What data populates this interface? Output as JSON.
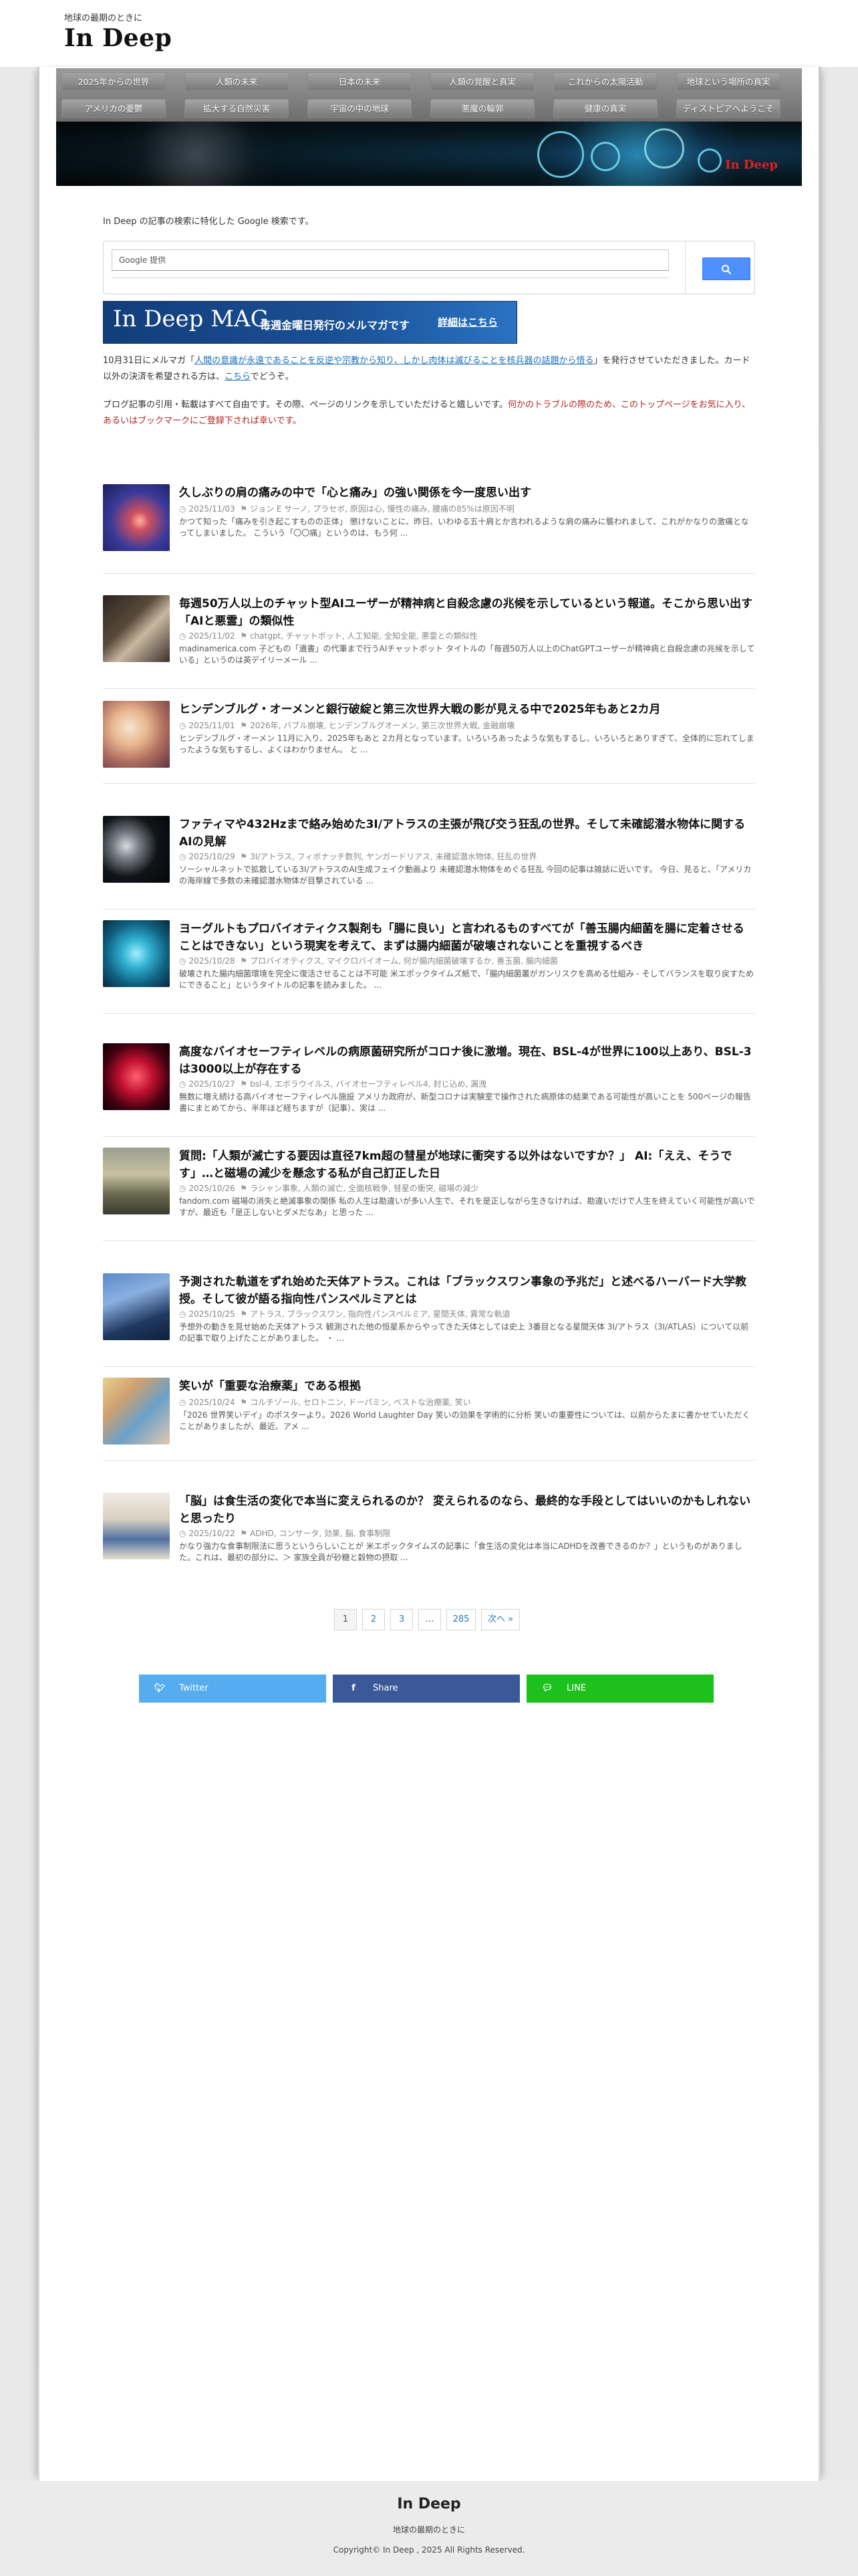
{
  "site": {
    "tagline": "地球の最期のときに",
    "title": "In Deep"
  },
  "nav": {
    "row1": [
      "2025年からの世界",
      "人類の未来",
      "日本の未来",
      "人類の覚醒と真実",
      "これからの太陽活動",
      "地球という場所の真実"
    ],
    "row2": [
      "アメリカの憂鬱",
      "拡大する自然災害",
      "宇宙の中の地球",
      "悪魔の輪郭",
      "健康の真実",
      "ディストピアへようこそ"
    ]
  },
  "banner": {
    "title": "In Deep"
  },
  "search": {
    "note": "In Deep の記事の検索に特化した Google 検索です。",
    "placeholder": "Google 提供",
    "button_icon": "search-icon"
  },
  "mag": {
    "title": "In Deep MAG",
    "subtitle": "毎週金曜日発行のメルマガです",
    "cta": "詳細はこちら"
  },
  "intro": {
    "p1_a": "10月31日にメルマガ「",
    "p1_link": "人間の意識が永遠であることを反逆や宗教から知り、しかし肉体は滅びることを核兵器の話題から悟る",
    "p1_b": "」を発行させていただきました。カード以外の決済を希望される方は、",
    "p1_link2": "こちら",
    "p1_c": "でどうぞ。",
    "p2_a": "ブログ記事の引用・転載はすべて自由です。その際、ページのリンクを示していただけると嬉しいです。",
    "p2_red": "何かのトラブルの際のため、このトップページをお気に入り、あるいはブックマークにご登録下されば幸いです。"
  },
  "articles": [
    {
      "title": "久しぶりの肩の痛みの中で「心と痛み」の強い関係を今一度思い出す",
      "date": "2025/11/03",
      "tags": "ジョン E サーノ, プラセボ, 原因は心, 慢性の痛み, 腰痛の85%は原因不明",
      "excerpt": "かつて知った「痛みを引き起こすものの正体」 懲けないことに、昨日、いわゆる五十肩とか言われるような肩の痛みに襲われまして、これがかなりの激痛となってしまいました。 こういう「〇〇痛」というのは、もう何 ..."
    },
    {
      "title": "毎週50万人以上のチャット型AIユーザーが精神病と自殺念慮の兆候を示しているという報道。そこから思い出す「AIと悪霊」の類似性",
      "date": "2025/11/02",
      "tags": "chatgpt, チャットボット, 人工知能, 全知全能, 悪霊との類似性",
      "excerpt": "madinamerica.com 子どもの「遺書」の代筆まで行うAIチャットボット タイトルの「毎週50万人以上のChatGPTユーザーが精神病と自殺念慮の兆候を示している」というのは英デイリーメール ..."
    },
    {
      "title": "ヒンデンブルグ・オーメンと銀行破綻と第三次世界大戦の影が見える中で2025年もあと2カ月",
      "date": "2025/11/01",
      "tags": "2026年, バブル崩壊, ヒンデンブルグオーメン, 第三次世界大戦, 金融崩壊",
      "excerpt": "ヒンデンブルグ・オーメン 11月に入り、2025年もあと 2カ月となっています。いろいろあったような気もするし、いろいろとありすぎて、全体的に忘れてしまったような気もするし、よくはわかりません。 と ..."
    },
    {
      "title": "ファティマや432Hzまで絡み始めた3I/アトラスの主張が飛び交う狂乱の世界。そして未確認潜水物体に関するAIの見解",
      "date": "2025/10/29",
      "tags": "3I/アトラス, フィボナッチ数列, ヤンガードリアス, 未確認潜水物体, 狂乱の世界",
      "excerpt": "ソーシャルネットで拡散している3I/アトラスのAI生成フェイク動画より 未確認潜水物体をめぐる狂乱 今回の記事は雑誌に近いです。 今日、見ると、「アメリカの海岸線で多数の未確認潜水物体が目撃されている ..."
    },
    {
      "title": "ヨーグルトもプロバイオティクス製剤も「腸に良い」と言われるものすべてが「善玉腸内細菌を腸に定着させることはできない」という現実を考えて、まずは腸内細菌が破壊されないことを重視するべき",
      "date": "2025/10/28",
      "tags": "プロバイオティクス, マイクロバイオーム, 何が腸内細菌破壊するか, 善玉菌, 腸内細菌",
      "excerpt": "破壊された腸内細菌環境を完全に復活させることは不可能 米エポックタイムズ紙で、「腸内細菌叢がガンリスクを高める仕組み - そしてバランスを取り戻すためにできること」というタイトルの記事を読みました。 ..."
    },
    {
      "title": "高度なバイオセーフティレベルの病原菌研究所がコロナ後に激増。現在、BSL-4が世界に100以上あり、BSL-3は3000以上が存在する",
      "date": "2025/10/27",
      "tags": "bsl-4, エボラウイルス, バイオセーフティレベル4, 封じ込め, 漏洩",
      "excerpt": "無数に増え続ける高バイオセーフティレベル施設 アメリカ政府が、新型コロナは実験室で操作された病原体の結果である可能性が高いことを 500ページの報告書にまとめてから、半年ほど経ちますが（記事）、実は ..."
    },
    {
      "title": "質問:「人類が滅亡する要因は直径7km超の彗星が地球に衝突する以外はないですか？」 AI:「ええ、そうです」…と磁場の減少を懸念する私が自己訂正した日",
      "date": "2025/10/26",
      "tags": "ラシャン事象, 人類の滅亡, 全面核戦争, 彗星の衝突, 磁場の減少",
      "excerpt": "fandom.com 磁場の消失と絶滅事象の関係 私の人生は勘違いが多い人生で、それを是正しながら生きなければ、勘違いだけで人生を終えていく可能性が高いですが、最近も「是正しないとダメだなあ」と思った ..."
    },
    {
      "title": "予測された軌道をずれ始めた天体アトラス。これは「ブラックスワン事象の予兆だ」と述べるハーバード大学教授。そして彼が語る指向性パンスペルミアとは",
      "date": "2025/10/25",
      "tags": "アトラス, ブラックスワン, 指向性パンスペルミア, 星間天体, 異常な軌道",
      "excerpt": "予想外の動きを見せ始めた天体アトラス 観測された他の恒星系からやってきた天体としては史上 3番目となる星間天体 3I/アトラス（3I/ATLAS）について以前の記事で取り上げたことがありました。 ・ ..."
    },
    {
      "title": "笑いが「重要な治療薬」である根拠",
      "date": "2025/10/24",
      "tags": "コルチゾール, セロトニン, ドーパミン, ベストな治療薬, 笑い",
      "excerpt": "「2026 世界笑いデイ」のポスターより。2026 World Laughter Day 笑いの効果を学術的に分析 笑いの重要性については、以前からたまに書かせていただくことがありましたが、最近、アメ ..."
    },
    {
      "title": "「脳」は食生活の変化で本当に変えられるのか？ 変えられるのなら、最終的な手段としてはいいのかもしれないと思ったり",
      "date": "2025/10/22",
      "tags": "ADHD, コンサータ, 効果, 脳, 食事制限",
      "excerpt": "かなり強力な食事制限法に思うというらしいことが 米エポックタイムズの記事に「食生活の変化は本当にADHDを改善できるのか？」というものがありました。これは、最初の部分に、＞ 家族全員が砂糖と穀物の摂取 ..."
    }
  ],
  "pagination": [
    "1",
    "2",
    "3",
    "…",
    "285",
    "次へ »"
  ],
  "share": {
    "twitter": "Twitter",
    "facebook": "Share",
    "line": "LINE",
    "twitter_icon": "twitter-icon",
    "facebook_icon": "facebook-icon",
    "line_icon": "line-icon"
  },
  "colors": {
    "twitter": "#55acee",
    "facebook": "#3b5998",
    "line": "#1dc11d",
    "link": "#1a6fbf",
    "notice_red": "#b22222"
  },
  "footer": {
    "title": "In Deep",
    "tagline": "地球の最期のときに",
    "copyright": "Copyright© In Deep , 2025 All Rights Reserved."
  }
}
